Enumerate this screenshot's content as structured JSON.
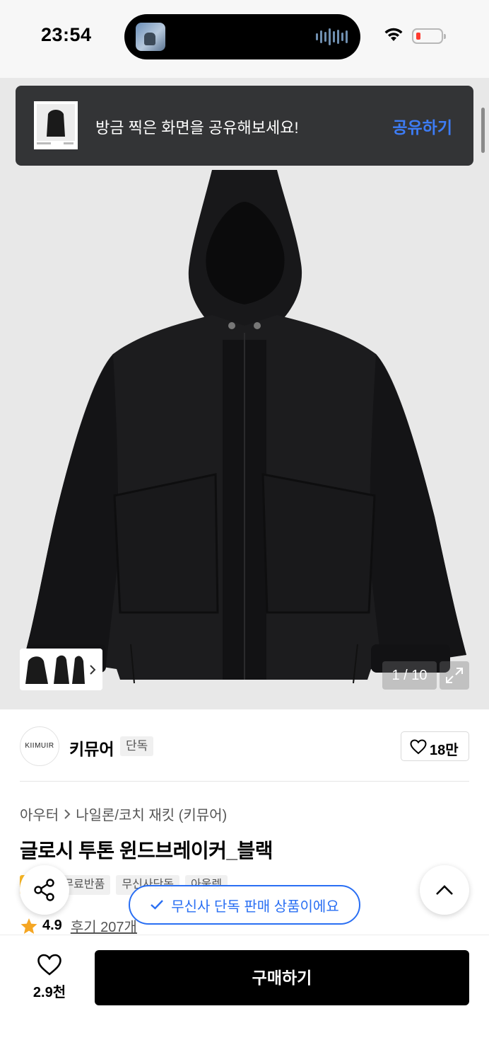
{
  "status_bar": {
    "time": "23:54",
    "battery_level": 0.15,
    "battery_color": "#ff3b30"
  },
  "toast": {
    "message": "방금 찍은 화면을 공유해보세요!",
    "action": "공유하기",
    "action_color": "#3d7cf6"
  },
  "gallery": {
    "counter": "1 / 10",
    "current": 1,
    "total": 10
  },
  "brand": {
    "logo_text": "KIIMUIR",
    "name": "키뮤어",
    "badge": "단독",
    "likes": "18만"
  },
  "breadcrumb": {
    "category": "아우터",
    "subcategory": "나일론/코치 재킷 (키뮤어)"
  },
  "product": {
    "title": "글로시 투톤 윈드브레이커_블랙",
    "tags": [
      "세일",
      "무료반품",
      "무신사단독",
      "아울렛"
    ],
    "rating": "4.9",
    "reviews": "후기 207개",
    "rating_color": "#f5a623"
  },
  "exclusive_notice": "무신사 단독 판매 상품이에요",
  "bottom_bar": {
    "wish_count": "2.9천",
    "buy_label": "구매하기"
  },
  "icons": [
    "search-icon",
    "share-icon",
    "heart-icon",
    "chevron-up-icon",
    "check-icon",
    "expand-icon",
    "star-icon",
    "wifi-icon",
    "battery-icon"
  ]
}
